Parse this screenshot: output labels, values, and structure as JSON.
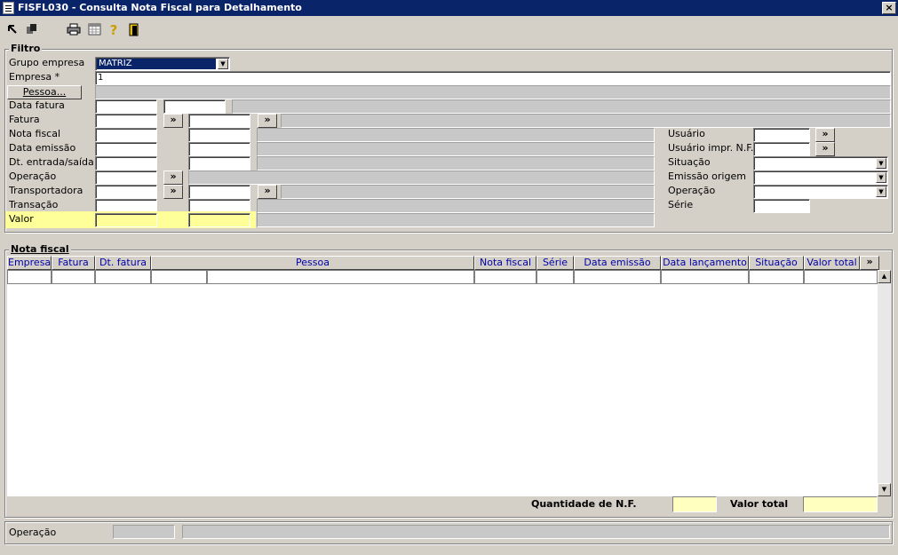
{
  "window": {
    "title": "FISFL030 - Consulta Nota Fiscal para Detalhamento",
    "close_glyph": "×"
  },
  "toolbar": {
    "icons": [
      "arrow-icon",
      "copy-icon",
      "print-icon",
      "calendar-icon",
      "help-icon",
      "exit-door-icon"
    ],
    "help_glyph": "?"
  },
  "filter": {
    "legend": "Filtro",
    "grupo_empresa_label": "Grupo empresa",
    "grupo_empresa_value": "MATRIZ",
    "empresa_label": "Empresa *",
    "empresa_value": "1",
    "pessoa_button": "Pessoa...",
    "data_fatura_label": "Data fatura",
    "fatura_label": "Fatura",
    "nota_fiscal_label": "Nota fiscal",
    "data_emissao_label": "Data emissão",
    "dt_entrada_saida_label": "Dt. entrada/saída",
    "operacao_label": "Operação",
    "transportadora_label": "Transportadora",
    "transacao_label": "Transação",
    "valor_label": "Valor",
    "usuario_label": "Usuário",
    "usuario_impr_label": "Usuário impr. N.F.",
    "situacao_label": "Situação",
    "emissao_origem_label": "Emissão origem",
    "operacao_right_label": "Operação",
    "serie_label": "Série",
    "lookup_glyph": "»"
  },
  "nota_fiscal": {
    "legend": "Nota fiscal",
    "columns": [
      "Empresa",
      "Fatura",
      "Dt. fatura",
      "Pessoa",
      "Nota fiscal",
      "Série",
      "Data emissão",
      "Data lançamento",
      "Situação",
      "Valor total"
    ],
    "more_columns_glyph": "»",
    "quantidade_label": "Quantidade de N.F.",
    "valor_total_label": "Valor total"
  },
  "status": {
    "operacao_label": "Operação"
  }
}
